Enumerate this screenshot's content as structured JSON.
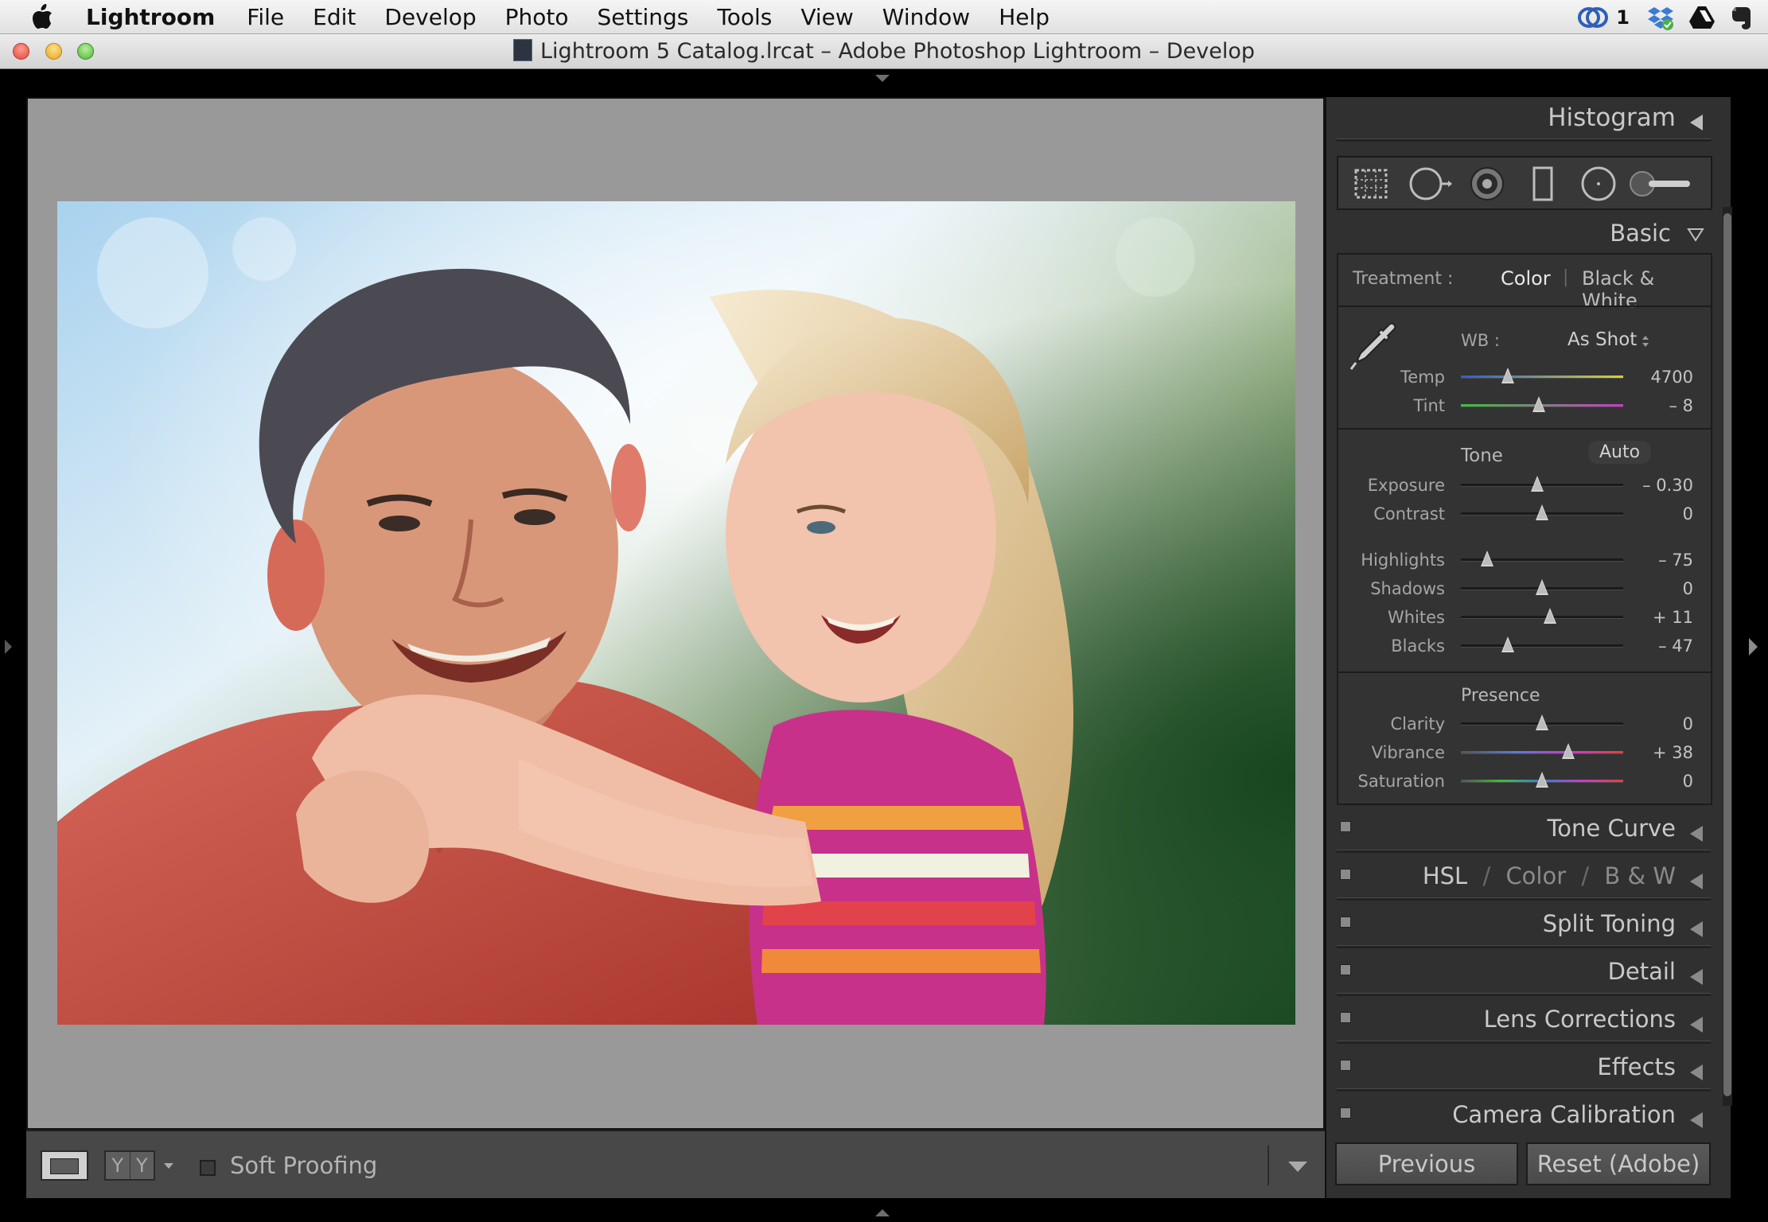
{
  "menubar": {
    "app_name": "Lightroom",
    "items": [
      "File",
      "Edit",
      "Develop",
      "Photo",
      "Settings",
      "Tools",
      "View",
      "Window",
      "Help"
    ],
    "status_count": "1"
  },
  "window": {
    "title": "Lightroom 5 Catalog.lrcat – Adobe Photoshop Lightroom – Develop"
  },
  "toolbar": {
    "compare_left": "Y",
    "compare_right": "Y",
    "soft_proofing": "Soft Proofing",
    "soft_proofing_checked": false
  },
  "panels": {
    "histogram": "Histogram",
    "basic": {
      "title": "Basic",
      "treatment_label": "Treatment :",
      "treatment_color": "Color",
      "treatment_sep": "|",
      "treatment_bw": "Black & White",
      "wb_label": "WB :",
      "wb_value": "As Shot",
      "tone_label": "Tone",
      "auto_label": "Auto",
      "presence_label": "Presence",
      "sliders": {
        "temp": {
          "label": "Temp",
          "value": "4700",
          "fraction": 0.29
        },
        "tint": {
          "label": "Tint",
          "value": "– 8",
          "fraction": 0.48
        },
        "exposure": {
          "label": "Exposure",
          "value": "– 0.30",
          "fraction": 0.47
        },
        "contrast": {
          "label": "Contrast",
          "value": "0",
          "fraction": 0.5
        },
        "highlights": {
          "label": "Highlights",
          "value": "– 75",
          "fraction": 0.16
        },
        "shadows": {
          "label": "Shadows",
          "value": "0",
          "fraction": 0.5
        },
        "whites": {
          "label": "Whites",
          "value": "+ 11",
          "fraction": 0.55
        },
        "blacks": {
          "label": "Blacks",
          "value": "– 47",
          "fraction": 0.29
        },
        "clarity": {
          "label": "Clarity",
          "value": "0",
          "fraction": 0.5
        },
        "vibrance": {
          "label": "Vibrance",
          "value": "+ 38",
          "fraction": 0.66
        },
        "saturation": {
          "label": "Saturation",
          "value": "0",
          "fraction": 0.5
        }
      }
    },
    "tone_curve": "Tone Curve",
    "hsl": {
      "hsl": "HSL",
      "slash1": "/",
      "color": "Color",
      "slash2": "/",
      "bw": "B & W"
    },
    "split_toning": "Split Toning",
    "detail": "Detail",
    "lens_corrections": "Lens Corrections",
    "effects": "Effects",
    "camera_calibration": "Camera Calibration"
  },
  "buttons": {
    "previous": "Previous",
    "reset": "Reset (Adobe)"
  },
  "colors": {
    "panel_bg": "#303030",
    "image_bg": "#999999",
    "text": "#c9c9c9"
  }
}
